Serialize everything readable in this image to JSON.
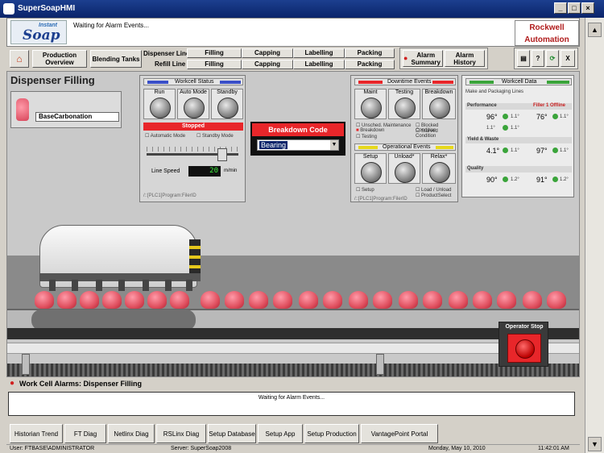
{
  "window": {
    "title": "SuperSoapHMI"
  },
  "header": {
    "logo_top": "Instant",
    "logo_main": "Soap",
    "message": "Waiting for Alarm Events...",
    "brand_line1": "Rockwell",
    "brand_line2": "Automation"
  },
  "nav": {
    "production_overview": "Production Overview",
    "blending_tanks": "Blending Tanks",
    "dispenser_line_label": "Dispenser Line",
    "refill_line_label": "Refill Line",
    "dispenser_items": [
      "Filling",
      "Capping",
      "Labelling",
      "Packing"
    ],
    "refill_items": [
      "Filling",
      "Capping",
      "Labelling",
      "Packing"
    ],
    "alarm_summary": "Alarm Summary",
    "alarm_history": "Alarm History",
    "help": "?",
    "close": "X"
  },
  "page": {
    "title": "Dispenser Filling",
    "product": "BaseCarbonation"
  },
  "workcell_status": {
    "title": "Workcell Status",
    "knobs": [
      "Run",
      "Auto Mode",
      "Standby"
    ],
    "state": "Stopped",
    "checks": [
      "Automatic Mode",
      "Standby Mode"
    ],
    "line_speed_label": "Line Speed",
    "line_speed_value": "20",
    "line_speed_unit": "m/min",
    "path": "/::[PLC1]Program:FilerID"
  },
  "breakdown": {
    "title": "Breakdown Code",
    "selected": "Bearing"
  },
  "downtime": {
    "title": "Downtime Events",
    "knobs": [
      "Maint",
      "Testing",
      "Breakdown"
    ],
    "checks_left": [
      "Unsched. Maintenance",
      "Breakdown",
      "Testing"
    ],
    "checks_right": [
      "Blocked Condition",
      "Starved Condition"
    ],
    "operational_title": "Operational Events",
    "op_knobs": [
      "Setup",
      "Unload*",
      "Relax*"
    ],
    "op_checks": [
      "Setup",
      "Load / Unload",
      "ProductSelect"
    ],
    "path": "/::[PLC1]Program:FilerID"
  },
  "workcell_data": {
    "title": "Workcell Data",
    "subtitle": "Make and Packaging Lines",
    "filler_label": "Filler 1 Offline",
    "sections": [
      {
        "name": "Performance",
        "values": [
          "96°",
          "1.1°",
          "76°",
          "1.1°",
          "1.1°",
          "1.1°"
        ]
      },
      {
        "name": "Yield & Waste",
        "values": [
          "4.1°",
          "1.1°",
          "97°",
          "1.1°"
        ]
      },
      {
        "name": "Quality",
        "values": [
          "90°",
          "1.2°",
          "91°",
          "1.2°"
        ]
      }
    ]
  },
  "operator_stop": {
    "label": "Operator Stop"
  },
  "alarms": {
    "title": "Work Cell Alarms: Dispenser Filling",
    "message": "Waiting for Alarm Events..."
  },
  "footer_buttons": [
    "Historian Trend",
    "FT Diag",
    "Netlinx Diag",
    "RSLinx Diag",
    "Setup Database",
    "Setup App",
    "Setup Production",
    "VantagePoint Portal"
  ],
  "status": {
    "user": "User: FTBASE\\ADMINISTRATOR",
    "server": "Server: SuperSoap2008",
    "date": "Monday, May 10, 2010",
    "time": "11:42:01 AM"
  },
  "colors": {
    "alarm_red": "#e8262a",
    "title_blue": "#0a246a",
    "ok_green": "#3aa43a"
  }
}
